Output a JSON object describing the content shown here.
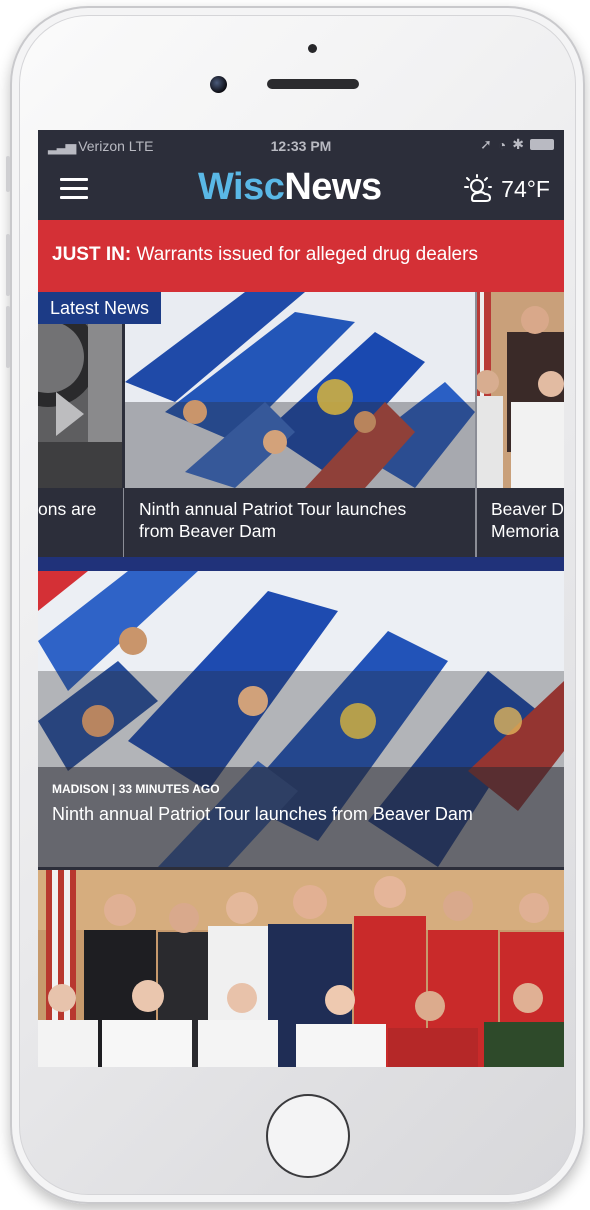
{
  "status_bar": {
    "carrier": "Verizon",
    "network": "LTE",
    "time": "12:33 PM"
  },
  "header": {
    "logo_part1": "Wisc",
    "logo_part2": "News",
    "weather_icon": "partly-sunny-icon",
    "temperature": "74°F"
  },
  "breaking": {
    "label": "JUST IN:",
    "headline": " Warrants issued for alleged drug dealers"
  },
  "latest_news": {
    "label": "Latest News",
    "cards": [
      {
        "caption_line1": "ons are",
        "caption_line2": ""
      },
      {
        "caption_line1": "Ninth annual Patriot Tour launches",
        "caption_line2": "from Beaver Dam"
      },
      {
        "caption_line1": "Beaver D",
        "caption_line2": "Memoria"
      }
    ]
  },
  "featured": {
    "meta": "MADISON | 33 MINUTES AGO",
    "title": "Ninth annual Patriot Tour launches from Beaver Dam"
  },
  "colors": {
    "nav_bg": "#2c2e3a",
    "breaking_bg": "#d43036",
    "accent_blue": "#1c3b86",
    "logo_blue": "#5ab8e6"
  }
}
